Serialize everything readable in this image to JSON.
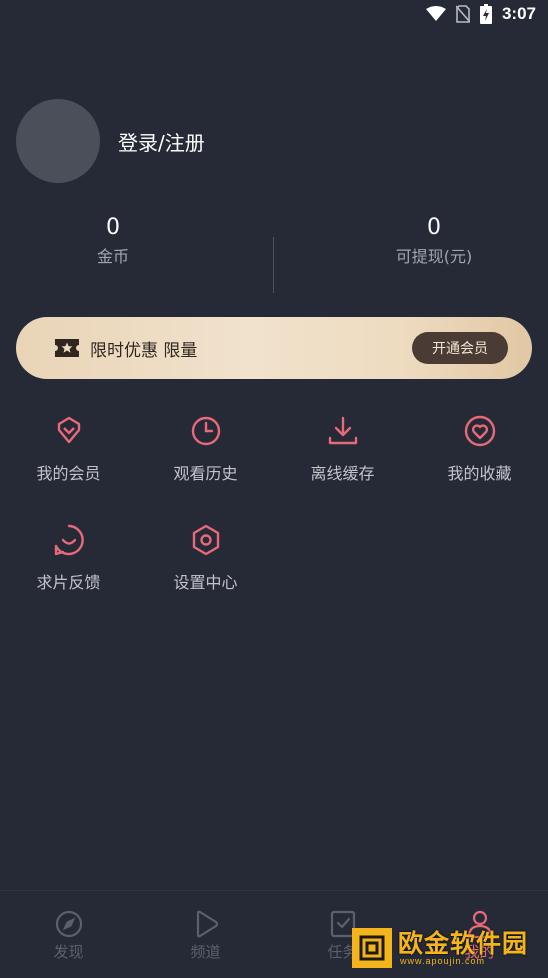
{
  "status_bar": {
    "time": "3:07",
    "icons": [
      "wifi-icon",
      "no-sim-icon",
      "battery-charging-icon"
    ]
  },
  "profile": {
    "login_label": "登录/注册"
  },
  "stats": [
    {
      "value": "0",
      "label": "金币"
    },
    {
      "value": "0",
      "label": "可提现(元)"
    }
  ],
  "vip_banner": {
    "text": "限时优惠 限量",
    "button_label": "开通会员",
    "icon": "ticket-star-icon"
  },
  "menu": [
    {
      "label": "我的会员",
      "icon": "diamond-icon"
    },
    {
      "label": "观看历史",
      "icon": "clock-icon"
    },
    {
      "label": "离线缓存",
      "icon": "download-icon"
    },
    {
      "label": "我的收藏",
      "icon": "heart-icon"
    },
    {
      "label": "求片反馈",
      "icon": "feedback-icon"
    },
    {
      "label": "设置中心",
      "icon": "settings-hexagon-icon"
    }
  ],
  "tabs": [
    {
      "label": "发现",
      "icon": "compass-icon",
      "active": false
    },
    {
      "label": "频道",
      "icon": "play-icon",
      "active": false
    },
    {
      "label": "任务",
      "icon": "task-check-icon",
      "active": false
    },
    {
      "label": "我的",
      "icon": "user-icon",
      "active": true
    }
  ],
  "watermark": {
    "brand": "欧金软件园",
    "url": "www.apoujin.com"
  },
  "colors": {
    "background": "#262a37",
    "accent": "#e8697a",
    "banner_gold": "#eedbc0",
    "banner_button": "#4a3b34"
  }
}
